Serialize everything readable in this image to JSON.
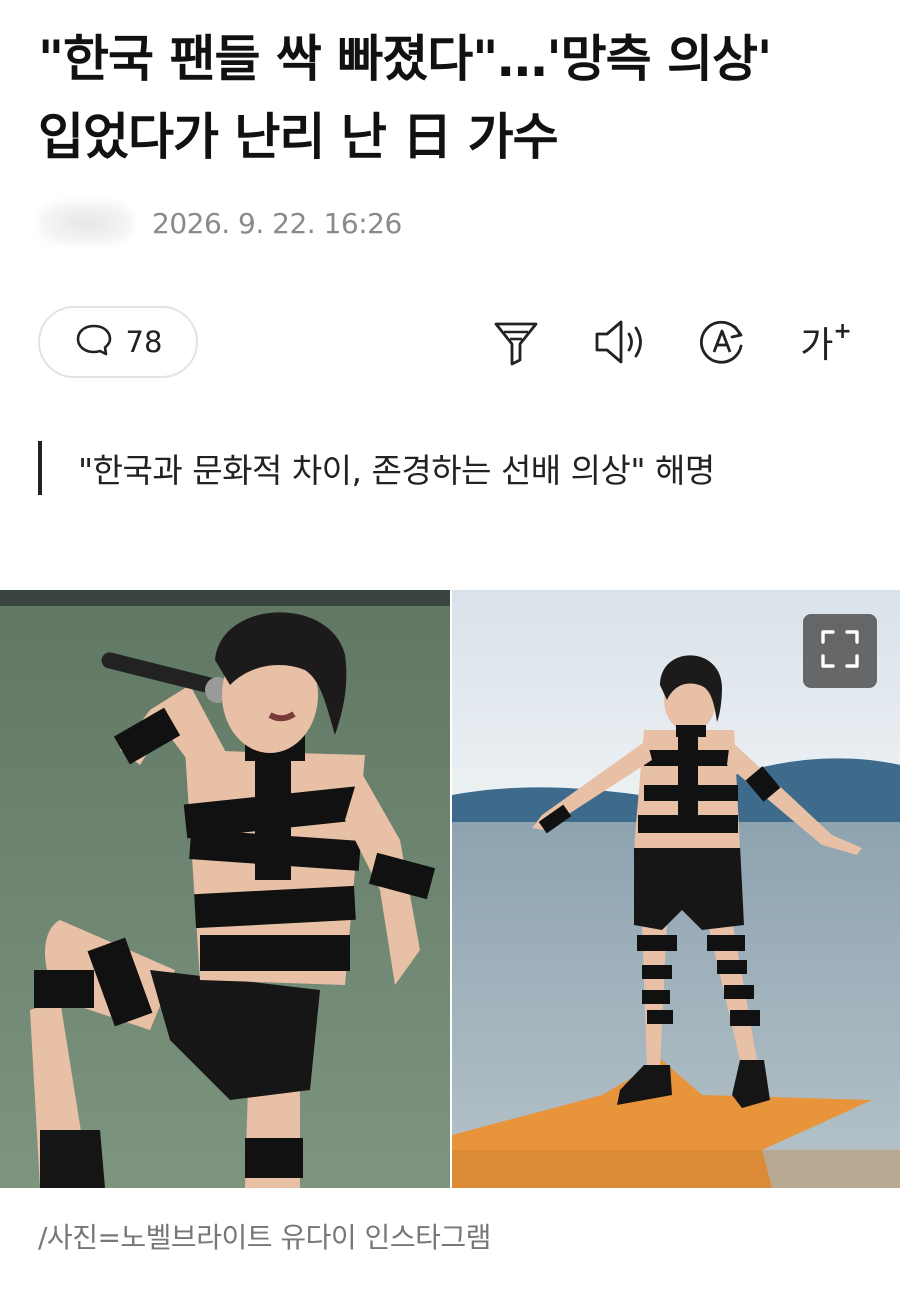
{
  "article": {
    "headline_line1": "\"한국 팬들 싹 빠졌다\"…'망측 의상'",
    "headline_line2": "입었다가 난리 난 日 가수",
    "datetime": "2026. 9. 22. 16:26",
    "comment_count": "78",
    "subheadline": "\"한국과 문화적 차이, 존경하는 선배 의상\" 해명",
    "photo_caption": "/사진=노벨브라이트 유다이 인스타그램"
  },
  "toolbar": {
    "font_size_label": "가",
    "font_size_plus": "+",
    "icons": [
      "comment-icon",
      "summary-filter-icon",
      "read-aloud-icon",
      "translate-icon",
      "font-size-icon",
      "expand-icon"
    ]
  },
  "colors": {
    "text": "#111111",
    "meta": "#8a8a8a",
    "caption": "#777777",
    "border": "#e3e3e3"
  }
}
